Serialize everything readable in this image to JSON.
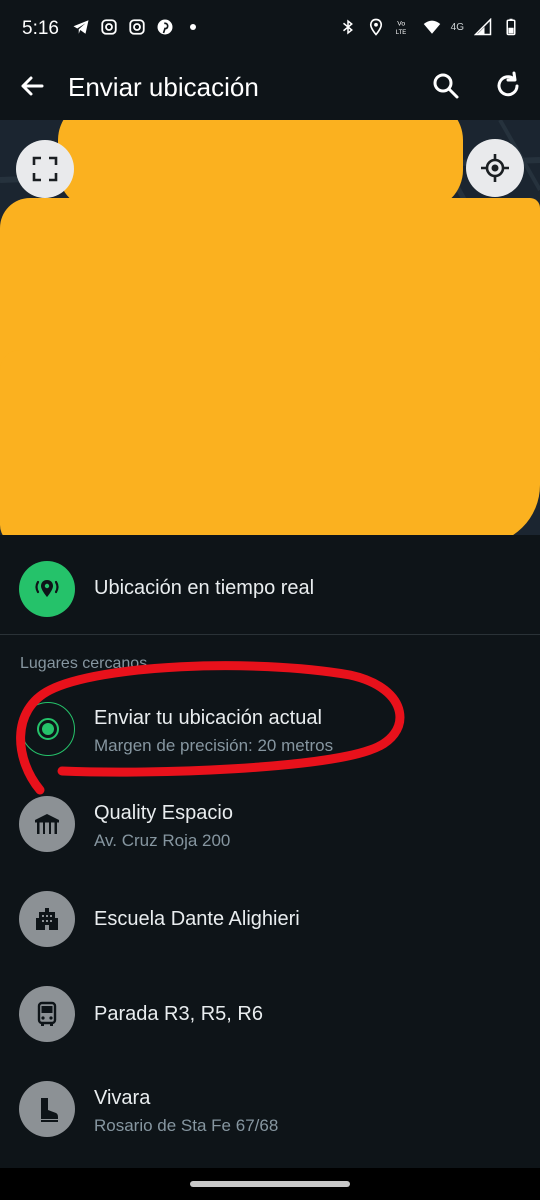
{
  "status_bar": {
    "time": "5:16",
    "network_label": "4G",
    "left_icons": [
      "telegram-icon",
      "instagram-icon",
      "instagram-icon",
      "pinterest-icon",
      "dot-icon"
    ],
    "right_icons": [
      "bluetooth-icon",
      "location-icon",
      "volte-icon",
      "wifi-icon",
      "signal-icon",
      "battery-icon"
    ]
  },
  "app_bar": {
    "title": "Enviar ubicación",
    "back_icon": "arrow-back-icon",
    "search_icon": "search-icon",
    "refresh_icon": "refresh-icon"
  },
  "map": {
    "expand_icon": "fullscreen-icon",
    "locate_icon": "my-location-icon",
    "redaction_color": "#fbb11f"
  },
  "live_location": {
    "label": "Ubicación en tiempo real",
    "icon": "live-location-icon",
    "icon_color": "#25c26a"
  },
  "nearby": {
    "header": "Lugares cercanos",
    "current": {
      "title": "Enviar tu ubicación actual",
      "subtitle": "Margen de precisión: 20 metros"
    },
    "places": [
      {
        "title": "Quality Espacio",
        "subtitle": "Av. Cruz Roja 200",
        "icon": "event-venue-icon"
      },
      {
        "title": "Escuela Dante Alighieri",
        "subtitle": "",
        "icon": "school-building-icon"
      },
      {
        "title": "Parada R3, R5, R6",
        "subtitle": "",
        "icon": "bus-icon"
      },
      {
        "title": "Vivara",
        "subtitle": "Rosario de Sta Fe 67/68",
        "icon": "boot-icon"
      }
    ]
  },
  "annotation_color": "#e8111b"
}
